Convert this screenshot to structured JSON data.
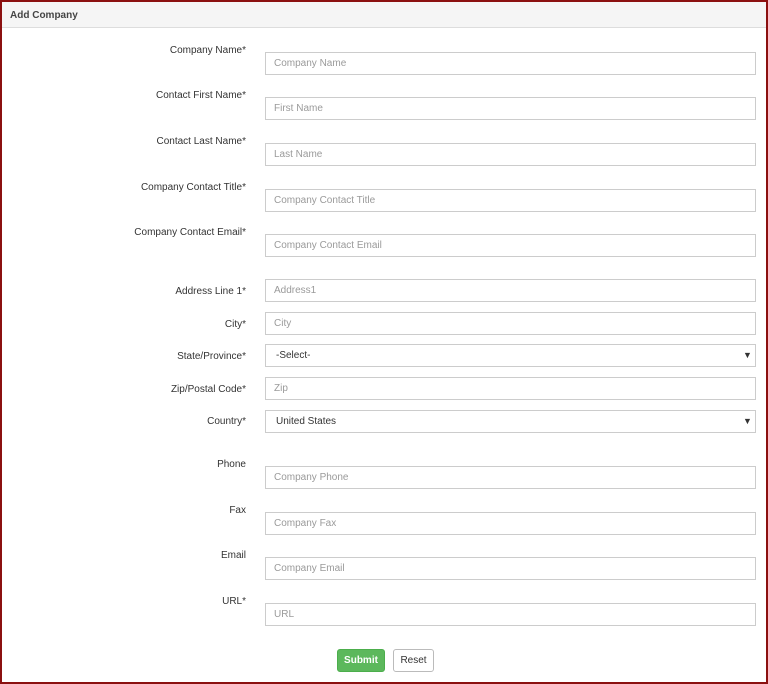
{
  "panel": {
    "title": "Add Company"
  },
  "fields": {
    "company_name": {
      "label": "Company Name*",
      "placeholder": "Company Name",
      "value": ""
    },
    "contact_first_name": {
      "label": "Contact First Name*",
      "placeholder": "First Name",
      "value": ""
    },
    "contact_last_name": {
      "label": "Contact Last Name*",
      "placeholder": "Last Name",
      "value": ""
    },
    "company_contact_title": {
      "label": "Company Contact Title*",
      "placeholder": "Company Contact Title",
      "value": ""
    },
    "company_contact_email": {
      "label": "Company Contact Email*",
      "placeholder": "Company Contact Email",
      "value": ""
    },
    "address_line_1": {
      "label": "Address Line 1*",
      "placeholder": "Address1",
      "value": ""
    },
    "city": {
      "label": "City*",
      "placeholder": "City",
      "value": ""
    },
    "state": {
      "label": "State/Province*",
      "selected": "-Select-"
    },
    "zip": {
      "label": "Zip/Postal Code*",
      "placeholder": "Zip",
      "value": ""
    },
    "country": {
      "label": "Country*",
      "selected": "United States"
    },
    "phone": {
      "label": "Phone",
      "placeholder": "Company Phone",
      "value": ""
    },
    "fax": {
      "label": "Fax",
      "placeholder": "Company Fax",
      "value": ""
    },
    "email": {
      "label": "Email",
      "placeholder": "Company Email",
      "value": ""
    },
    "url": {
      "label": "URL*",
      "placeholder": "URL",
      "value": ""
    }
  },
  "buttons": {
    "submit": "Submit",
    "reset": "Reset"
  },
  "icons": {
    "select_arrow": "▼"
  },
  "colors": {
    "border": "#8b1010",
    "submit": "#5cb85c"
  }
}
